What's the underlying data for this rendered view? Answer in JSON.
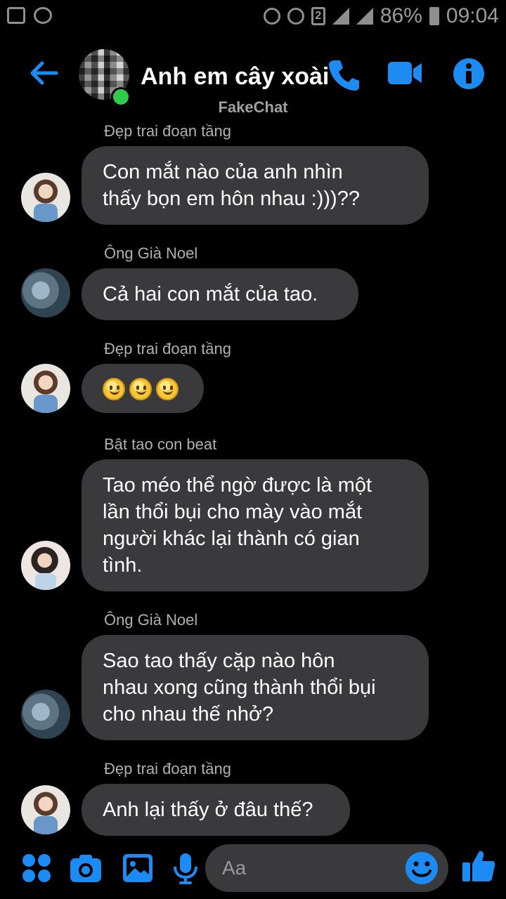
{
  "status_bar": {
    "battery": "86%",
    "time": "09:04",
    "sim": "2"
  },
  "header": {
    "title": "Anh em cây xoài",
    "subtitle": "FakeChat",
    "accent": "#1c8cf4"
  },
  "messages": [
    {
      "sender": "Đẹp trai đoạn tầng",
      "text": "Con mắt nào của anh nhìn\nthấy bọn em hôn nhau :)))??"
    },
    {
      "sender": "Ông Già Noel",
      "text": "Cả hai con mắt của tao."
    },
    {
      "sender": "Đẹp trai đoạn tầng",
      "emoji_count": 3
    },
    {
      "sender": "Bật tao con beat",
      "text": "Tao méo thể ngờ được là một\nlần thổi bụi cho mày vào mắt\nngười khác lại thành có gian\ntình."
    },
    {
      "sender": "Ông Già Noel",
      "text": "Sao tao thấy cặp nào hôn\nnhau xong cũng thành thổi bụi\ncho nhau thế nhở?"
    },
    {
      "sender": "Đẹp trai đoạn tầng",
      "text": "Anh lại thấy ở đâu thế?"
    }
  ],
  "composer": {
    "placeholder": "Aa"
  }
}
